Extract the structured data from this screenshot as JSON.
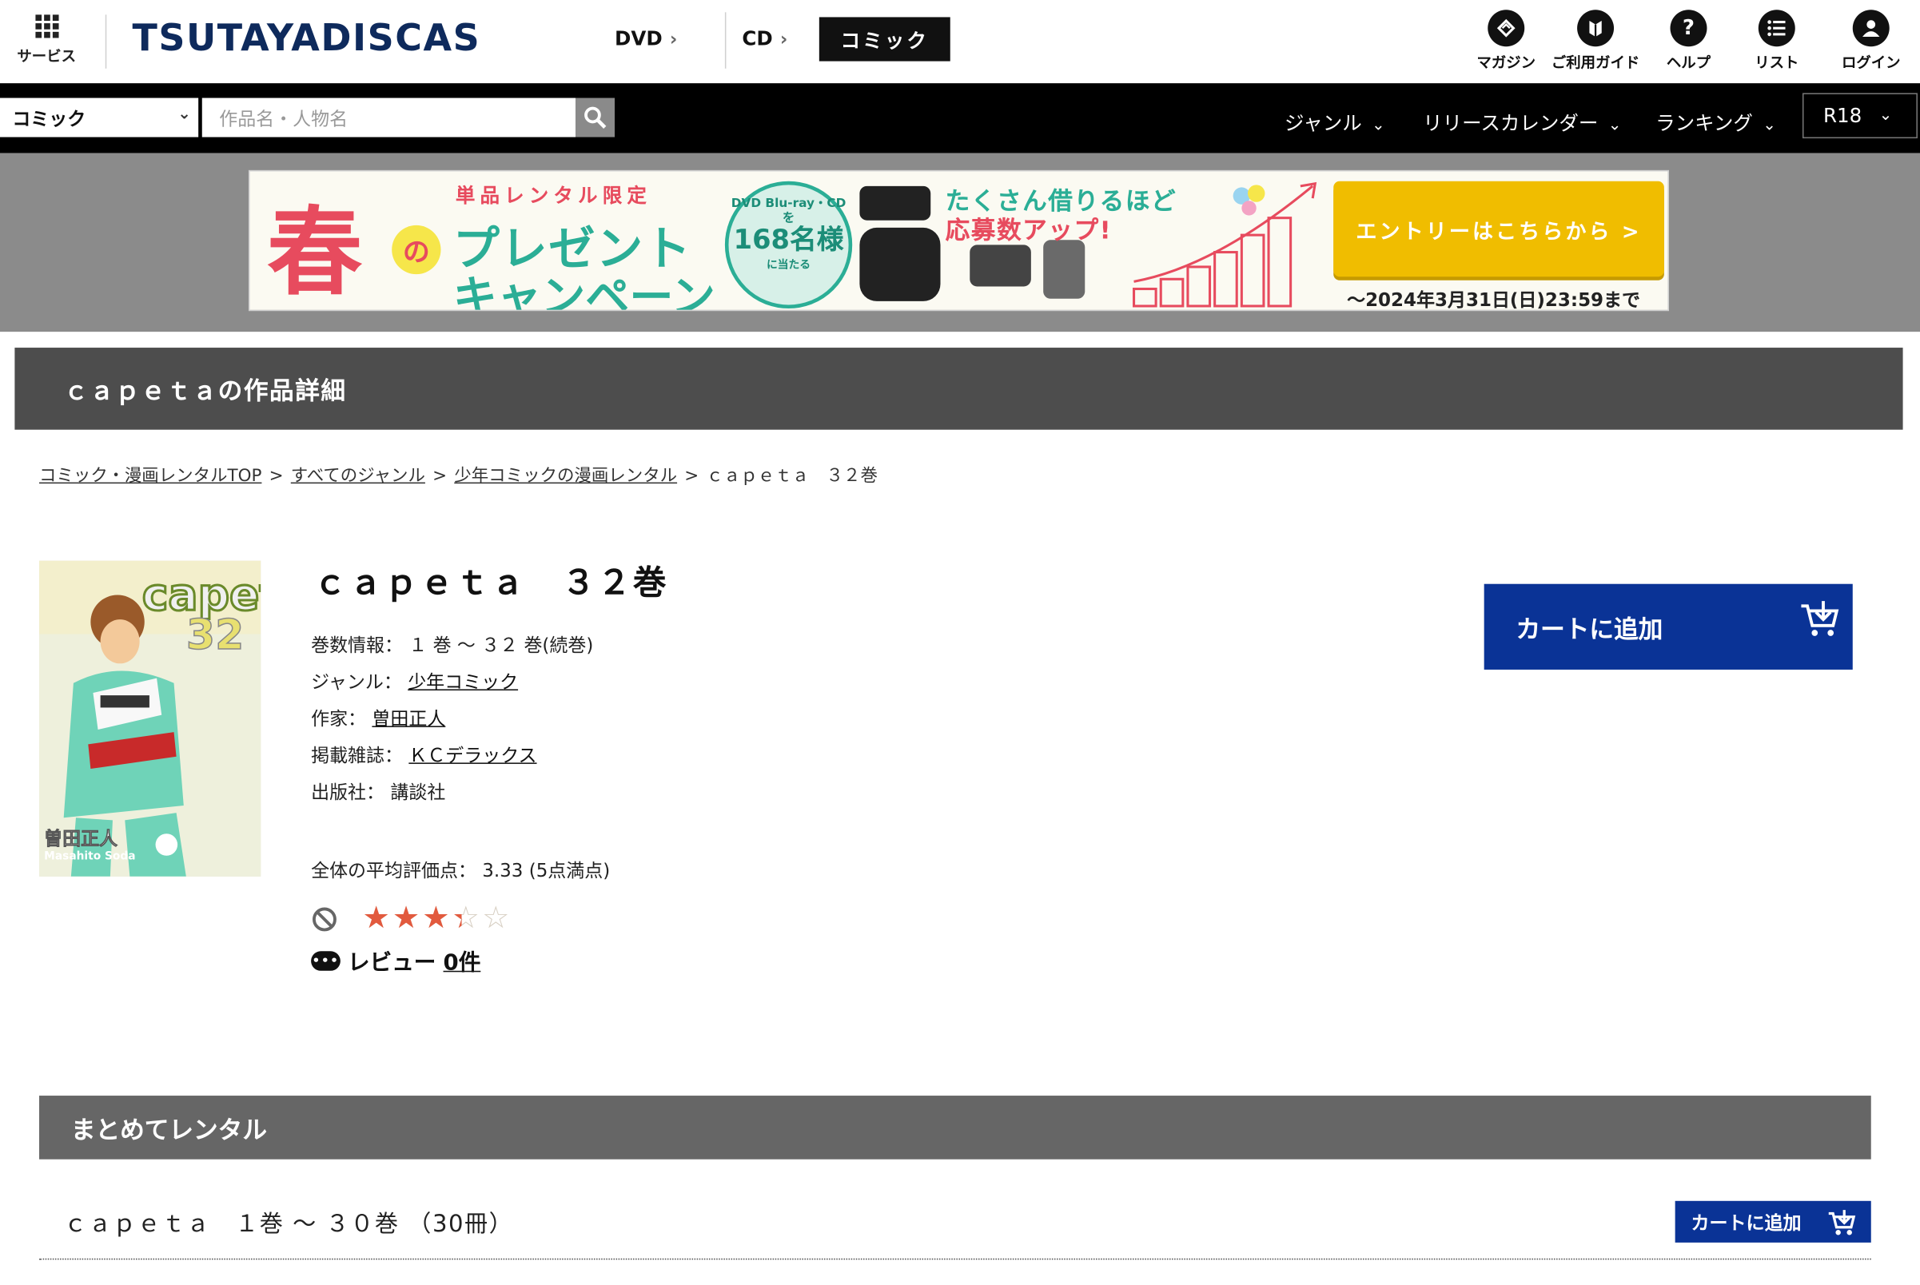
{
  "header": {
    "service_label": "サービス",
    "logo": "TSUTAYADISCAS",
    "tabs": [
      {
        "label": "DVD"
      },
      {
        "label": "CD"
      },
      {
        "label": "コミック"
      }
    ],
    "utilities": [
      {
        "label": "マガジン",
        "icon": "magazine-icon"
      },
      {
        "label": "ご利用ガイド",
        "icon": "guide-icon"
      },
      {
        "label": "ヘルプ",
        "icon": "help-icon"
      },
      {
        "label": "リスト",
        "icon": "list-icon"
      },
      {
        "label": "ログイン",
        "icon": "login-icon"
      }
    ]
  },
  "searchbar": {
    "category": "コミック",
    "placeholder": "作品名・人物名",
    "menus": [
      "ジャンル",
      "リリースカレンダー",
      "ランキング"
    ],
    "r18": "R18"
  },
  "banner": {
    "haru": "春",
    "no": "の",
    "limited": "単品レンタル限定",
    "title1": "プレゼント",
    "title2": "キャンペーン",
    "circle_a": "DVD Blu-ray・CDを",
    "circle_b": "168名様",
    "circle_c": "に当たる",
    "more1": "たくさん借りるほど",
    "more2": "応募数アップ!",
    "entry": "エントリーはこちらから >",
    "deadline": "〜2024年3月31日(日)23:59まで"
  },
  "page": {
    "title_bar": "ｃａｐｅｔａの作品詳細",
    "breadcrumbs": [
      "コミック・漫画レンタルTOP",
      "すべてのジャンル",
      "少年コミックの漫画レンタル",
      "ｃａｐｅｔａ　３２巻"
    ],
    "heading": "ｃａｐｅｔａ　３２巻",
    "info": {
      "volumes_label": "巻数情報：",
      "volumes_value": "１ 巻 〜 ３２ 巻(続巻)",
      "genre_label": "ジャンル：",
      "genre_value": "少年コミック",
      "author_label": "作家：",
      "author_value": "曽田正人",
      "magazine_label": "掲載雑誌：",
      "magazine_value": "ＫＣデラックス",
      "publisher_label": "出版社：",
      "publisher_value": "講談社"
    },
    "rating_label": "全体の平均評価点：",
    "rating_value": "3.33 (5点満点)",
    "rating": 3.33,
    "review_label": "レビュー",
    "review_count": "0件",
    "cart_button": "カートに追加",
    "cover": {
      "title": "capeta",
      "volume": "32",
      "author_jp": "曽田正人",
      "author_en": "Masahito Soda"
    }
  },
  "bundle": {
    "section_title": "まとめてレンタル",
    "row_title": "ｃａｐｅｔａ　１巻 〜 ３０巻 （30冊）",
    "cart_button": "カートに追加"
  },
  "colors": {
    "navy_button": "#0a3396",
    "logo": "#0e2a5c",
    "star": "#e25a3e",
    "title_bar": "#4d4d4d"
  }
}
